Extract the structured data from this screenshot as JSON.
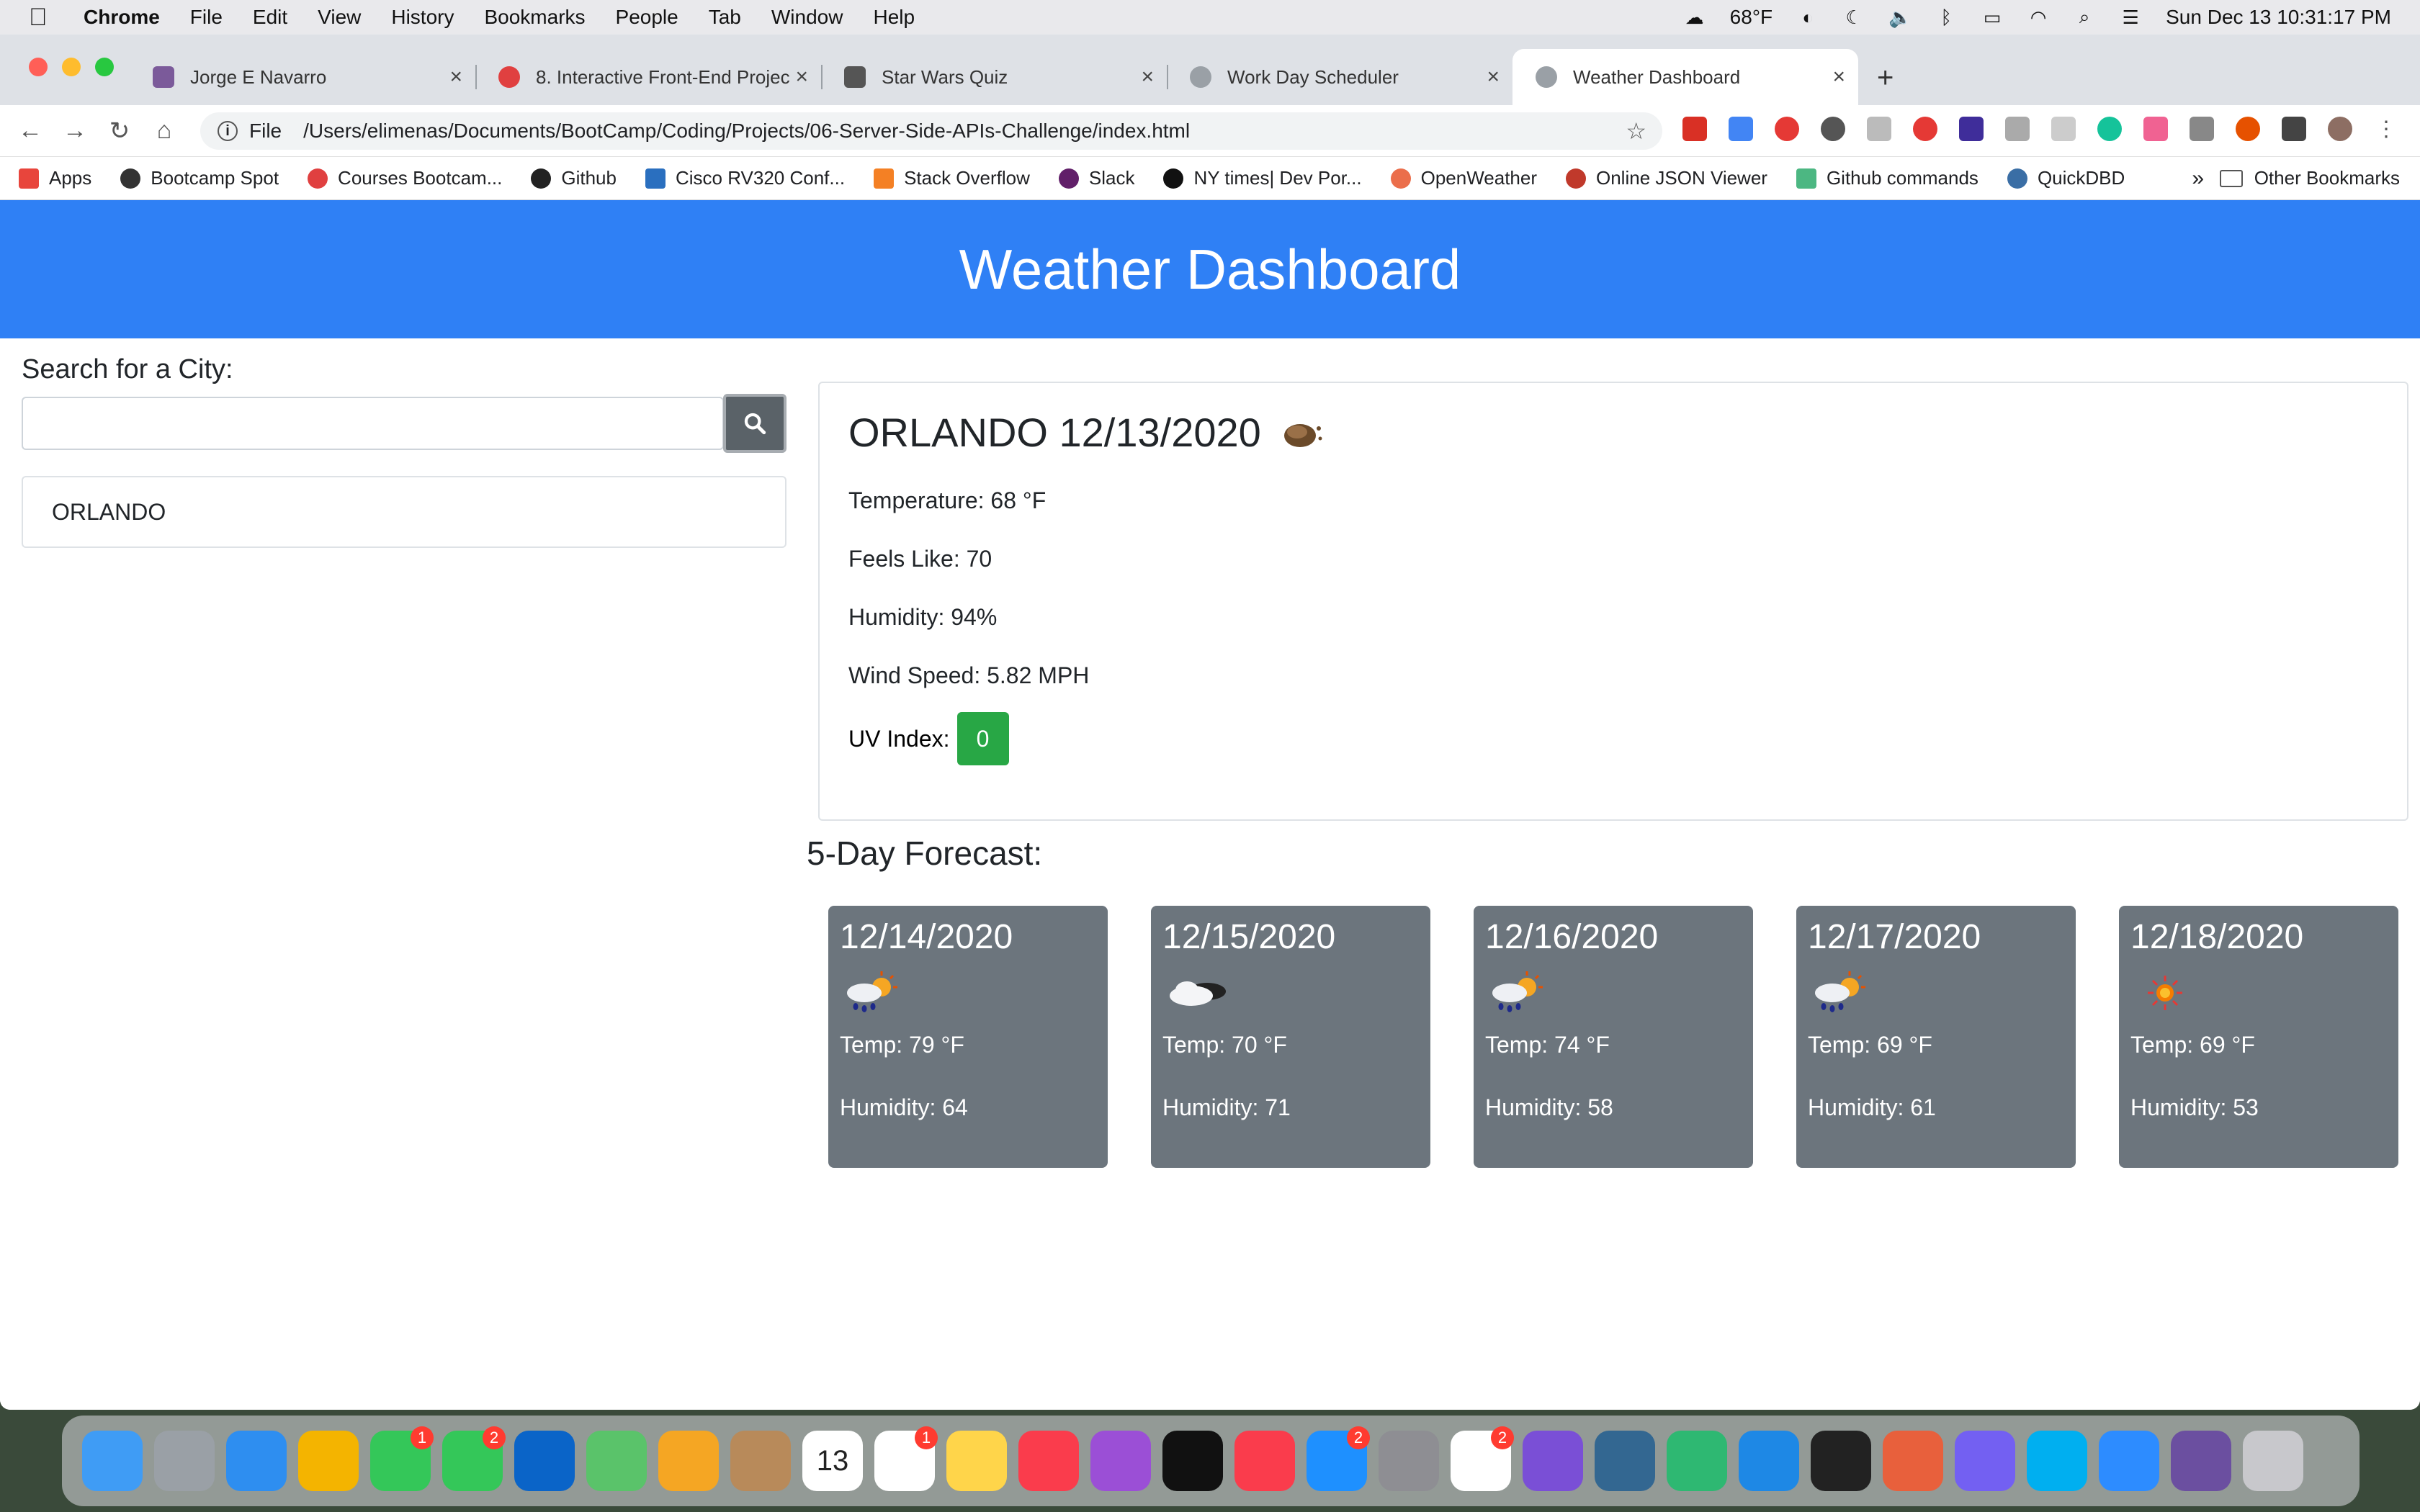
{
  "menubar": {
    "app": "Chrome",
    "items": [
      "File",
      "Edit",
      "View",
      "History",
      "Bookmarks",
      "People",
      "Tab",
      "Window",
      "Help"
    ],
    "weather": "68°F",
    "clock": "Sun Dec 13  10:31:17 PM"
  },
  "tabs": [
    {
      "title": "Jorge E Navarro",
      "color": "#7b5a9a"
    },
    {
      "title": "8. Interactive Front-End Projec",
      "color": "#e04040"
    },
    {
      "title": "Star Wars Quiz",
      "color": "#555555"
    },
    {
      "title": "Work Day Scheduler",
      "color": "#9aa0a6"
    },
    {
      "title": "Weather Dashboard",
      "color": "#9aa0a6"
    }
  ],
  "omnibox": {
    "scheme": "File",
    "url": "/Users/elimenas/Documents/BootCamp/Coding/Projects/06-Server-Side-APIs-Challenge/index.html"
  },
  "bookmarks": [
    {
      "label": "Apps",
      "color": "#e8453c"
    },
    {
      "label": "Bootcamp Spot",
      "color": "#333333"
    },
    {
      "label": "Courses Bootcam...",
      "color": "#e04040"
    },
    {
      "label": "Github",
      "color": "#222222"
    },
    {
      "label": "Cisco RV320 Conf...",
      "color": "#2a6fbf"
    },
    {
      "label": "Stack Overflow",
      "color": "#f48024"
    },
    {
      "label": "Slack",
      "color": "#611f69"
    },
    {
      "label": "NY times| Dev Por...",
      "color": "#111111"
    },
    {
      "label": "OpenWeather",
      "color": "#eb6e4b"
    },
    {
      "label": "Online JSON Viewer",
      "color": "#c0392b"
    },
    {
      "label": "Github commands",
      "color": "#4cb782"
    },
    {
      "label": "QuickDBD",
      "color": "#3a6ea5"
    }
  ],
  "bookmarks_more": "»",
  "bookmarks_other": "Other Bookmarks",
  "page": {
    "title": "Weather Dashboard",
    "search_label": "Search for a City:",
    "search_value": "",
    "history": [
      "ORLANDO"
    ],
    "current": {
      "heading": "ORLANDO 12/13/2020",
      "icon": "night-clouds-icon",
      "temperature": "Temperature: 68 °F",
      "feels_like": "Feels Like: 70",
      "humidity": "Humidity: 94%",
      "wind": "Wind Speed: 5.82 MPH",
      "uv_label": "UV Index:",
      "uv_value": "0",
      "uv_color": "#28a745"
    },
    "forecast_heading": "5-Day Forecast:",
    "forecast": [
      {
        "date": "12/14/2020",
        "icon": "rain-sun-icon",
        "temp": "Temp: 79 °F",
        "humidity": "Humidity: 64"
      },
      {
        "date": "12/15/2020",
        "icon": "cloud-icon",
        "temp": "Temp: 70 °F",
        "humidity": "Humidity: 71"
      },
      {
        "date": "12/16/2020",
        "icon": "rain-sun-icon",
        "temp": "Temp: 74 °F",
        "humidity": "Humidity: 58"
      },
      {
        "date": "12/17/2020",
        "icon": "rain-sun-icon",
        "temp": "Temp: 69 °F",
        "humidity": "Humidity: 61"
      },
      {
        "date": "12/18/2020",
        "icon": "sun-icon",
        "temp": "Temp: 69 °F",
        "humidity": "Humidity: 53"
      }
    ]
  },
  "dock": [
    {
      "name": "finder",
      "color": "#3f9cf5"
    },
    {
      "name": "launchpad",
      "color": "#9aa0a6"
    },
    {
      "name": "safari",
      "color": "#2e8ef0"
    },
    {
      "name": "chrome",
      "color": "#f4b400"
    },
    {
      "name": "messages",
      "color": "#34c759",
      "badge": "1"
    },
    {
      "name": "facetime",
      "color": "#34c759",
      "badge": "2"
    },
    {
      "name": "outlook",
      "color": "#0a64c8"
    },
    {
      "name": "maps",
      "color": "#5ac36a"
    },
    {
      "name": "photos",
      "color": "#f5a623"
    },
    {
      "name": "contacts",
      "color": "#b88a5a"
    },
    {
      "name": "calendar",
      "color": "#ffffff",
      "label": "13"
    },
    {
      "name": "reminders",
      "color": "#ffffff",
      "badge": "1"
    },
    {
      "name": "notes",
      "color": "#ffd54a"
    },
    {
      "name": "music",
      "color": "#fa3c4c"
    },
    {
      "name": "podcasts",
      "color": "#9b4fd6"
    },
    {
      "name": "tv",
      "color": "#111111"
    },
    {
      "name": "news",
      "color": "#fa3c4c"
    },
    {
      "name": "app-store",
      "color": "#1e90ff",
      "badge": "2"
    },
    {
      "name": "system-preferences",
      "color": "#8e8e93"
    },
    {
      "name": "slack",
      "color": "#ffffff",
      "badge": "2"
    },
    {
      "name": "github-desktop",
      "color": "#7a4fd6"
    },
    {
      "name": "postgres",
      "color": "#336791"
    },
    {
      "name": "cycle-app",
      "color": "#2eb872"
    },
    {
      "name": "vscode",
      "color": "#1e88e5"
    },
    {
      "name": "terminal",
      "color": "#222222"
    },
    {
      "name": "remote-desktop",
      "color": "#e8603c"
    },
    {
      "name": "viber",
      "color": "#7360f2"
    },
    {
      "name": "skype",
      "color": "#00aff0"
    },
    {
      "name": "zoom",
      "color": "#2d8cff"
    },
    {
      "name": "document",
      "color": "#6b4fa0"
    },
    {
      "name": "trash",
      "color": "#c8c8cc"
    }
  ]
}
